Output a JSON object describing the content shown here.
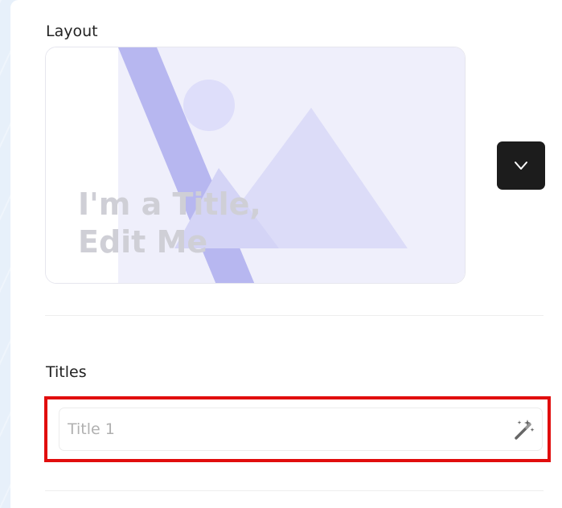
{
  "layout": {
    "label": "Layout",
    "preview_title_line1": "I'm a Title,",
    "preview_title_line2": "Edit Me",
    "preview_icon": "image-placeholder-icon",
    "dropdown_icon": "chevron-down-icon"
  },
  "titles": {
    "label": "Titles",
    "input_value": "",
    "input_placeholder": "Title 1",
    "magic_icon": "magic-wand-icon"
  },
  "colors": {
    "accent_purple": "#b9b9f2",
    "preview_bg": "#eeeefb",
    "highlight_border": "#e10d0d",
    "button_dark": "#1c1c1c"
  }
}
